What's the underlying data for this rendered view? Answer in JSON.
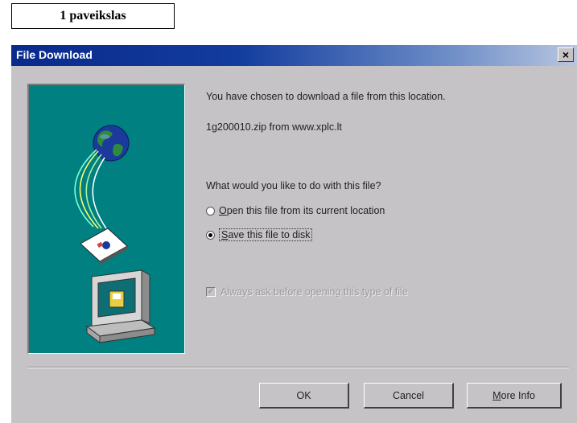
{
  "figure_label": "1 paveikslas",
  "dialog": {
    "title": "File Download",
    "close_glyph": "×",
    "message": "You have chosen to download a file from this location.",
    "file_source": "1g200010.zip from www.xplc.lt",
    "question": "What would you like to do with this file?",
    "options": [
      {
        "mnemonic": "O",
        "rest": "pen this file from its current location",
        "selected": false
      },
      {
        "mnemonic": "S",
        "rest": "ave this file to disk",
        "selected": true
      }
    ],
    "always_ask": {
      "label": "Always ask before opening this type of file",
      "checked": true,
      "enabled": false
    },
    "buttons": {
      "ok": "OK",
      "cancel": "Cancel",
      "more_info_mnemonic": "M",
      "more_info_rest": "ore Info"
    }
  },
  "icons": [
    "globe-icon",
    "document-icon",
    "computer-icon",
    "close-icon"
  ],
  "colors": {
    "titlebar_start": "#0a2a8c",
    "titlebar_end": "#b9c6e0",
    "dialog_face": "#c6c3c6",
    "illustration_bg": "#008080"
  }
}
